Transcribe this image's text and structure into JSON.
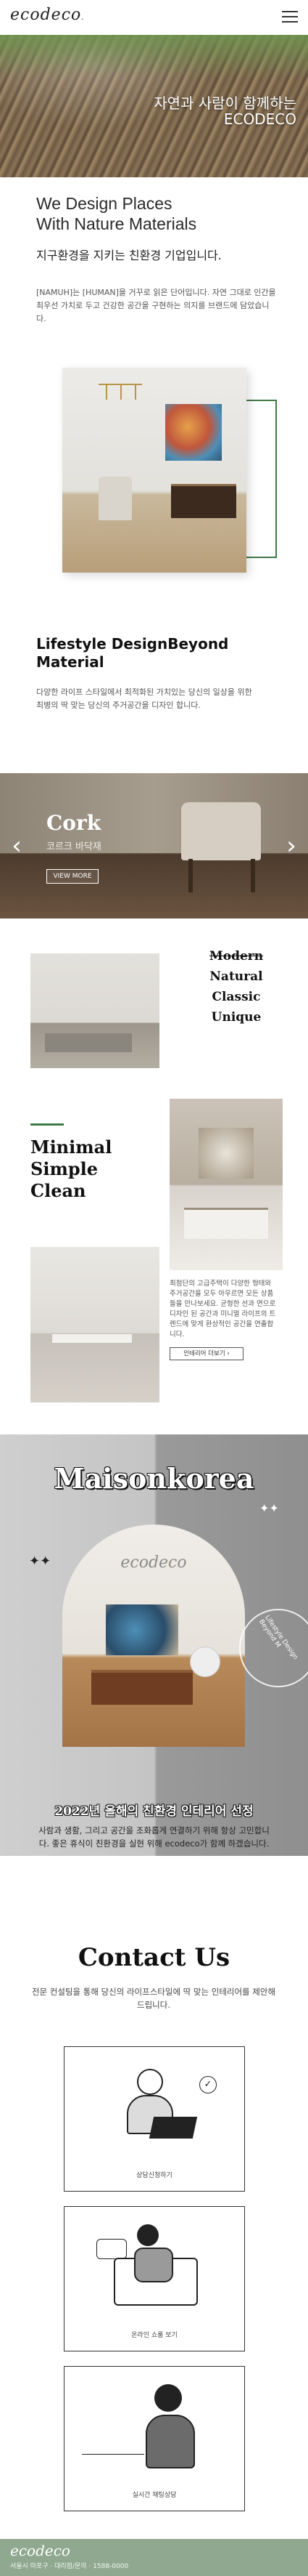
{
  "brand": {
    "logo": "ecodeco",
    "logo_dot": "."
  },
  "hero": {
    "line1": "자연과 사람이 함께하는",
    "line2": "ECODECO"
  },
  "intro": {
    "heading_line1": "We Design Places",
    "heading_line2": "With Nature Materials",
    "subheading": "지구환경을 지키는 친환경 기업입니다.",
    "paragraph": "[NAMUH]는 [HUMAN]을 거꾸로 읽은 단어입니다. 자연 그대로 인간을 최우선 가치로 두고 건강한 공간을 구현하는 의지를 브랜드에 담았습니다."
  },
  "lifestyle": {
    "heading": "Lifestyle DesignBeyond Material",
    "paragraph": "다양한 라이프 스타일에서 최적화된 가치있는 당신의 일상을 위한 최병의 딱 맞는 당신의 주거공간을 디자인 합니다."
  },
  "slider": {
    "title": "Cork",
    "subtitle": "코르크 바닥재",
    "button": "VIEW MORE",
    "prev": "‹",
    "next": "›"
  },
  "gallery": {
    "words": [
      "Modern",
      "Natural",
      "Classic",
      "Unique"
    ],
    "headline_lines": [
      "Minimal",
      "Simple",
      "Clean"
    ],
    "description": "최첨단의 고급주택이 다양한 형태와 주거공간을 모두 아우르면 모든 상품들을 만나보세요. 균형한 선과 면으로 디자인 된 공간과 미니멀 라이프의 트렌드에 맞게 환상적인 공간을 연출합니다.",
    "button": "인테리어 더보기 ›"
  },
  "award": {
    "title": "Maisonkorea",
    "arch_logo": "ecodeco",
    "stars": "✦✦",
    "badge_text": "Lifestyle Design Beyond M",
    "heading": "2022년 올해의 친환경 인테리어 선정",
    "paragraph": "사람과 생활, 그리고 공간을 조화롭게 연결하기 위해 항상 고민합니다. 좋은 휴식이 친환경을 실현 위해 ecodeco가 함께 하겠습니다."
  },
  "contact": {
    "title": "Contact Us",
    "paragraph": "전문 컨설팅을 통해 당신의 라이프스타일에 딱 맞는 인테리어를 제안해 드립니다.",
    "cards": [
      "상담신청하기",
      "온라인 쇼룸 보기",
      "실시간 채팅상담"
    ]
  },
  "footer": {
    "logo": "ecodeco",
    "info": "서울시 마포구 · 대리점/문의 · 1588-0000"
  },
  "colors": {
    "accent_green": "#3f7a46",
    "footer_green": "#8fa88f"
  }
}
